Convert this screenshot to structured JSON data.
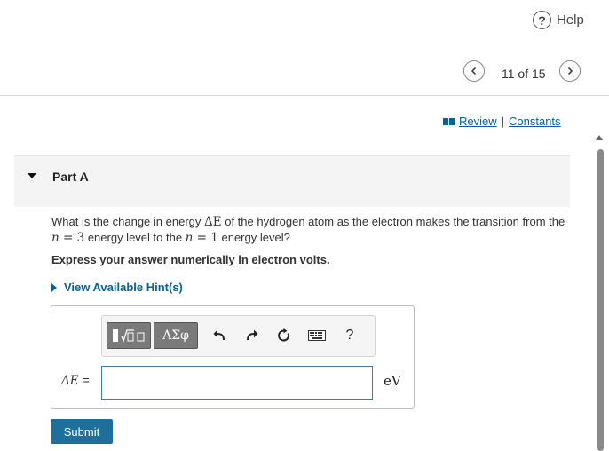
{
  "header": {
    "help_label": "Help",
    "help_glyph": "?",
    "pager_text": "11 of 15",
    "prev_icon": "chevron-left-icon",
    "next_icon": "chevron-right-icon"
  },
  "links": {
    "review": "Review",
    "separator": "|",
    "constants": "Constants"
  },
  "part": {
    "title": "Part A",
    "question_prefix": "What is the change in energy ",
    "question_symbol": "ΔE",
    "question_mid": " of the hydrogen atom as the electron makes the transition from the",
    "n_symbol": "n",
    "eq": " = ",
    "n_from": "3",
    "question_mid2": " energy level to the ",
    "n_to": "1",
    "question_end": " energy level?",
    "instruction": "Express your answer numerically in electron volts.",
    "hint_label": "View Available Hint(s)"
  },
  "answer": {
    "label_symbol": "ΔE",
    "label_eq": " =",
    "value": "",
    "unit": "eV",
    "toolbar": {
      "templates_icon": "math-templates-icon",
      "symbols_label": "ΑΣφ",
      "undo_icon": "undo-icon",
      "redo_icon": "redo-icon",
      "reset_icon": "reset-icon",
      "keyboard_icon": "keyboard-icon",
      "help_label": "?"
    },
    "submit_label": "Submit"
  },
  "colors": {
    "link": "#006699",
    "submit_bg": "#1f6f9c",
    "input_border": "#3a7fa8"
  }
}
